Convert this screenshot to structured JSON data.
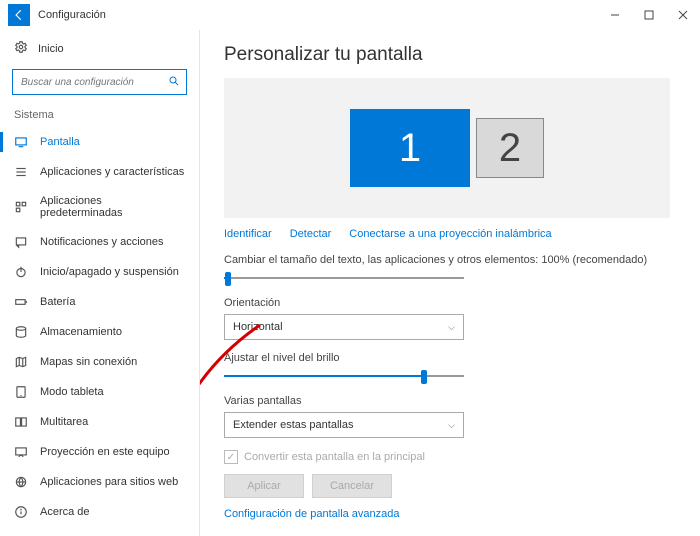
{
  "titlebar": {
    "title": "Configuración"
  },
  "sidebar": {
    "home_label": "Inicio",
    "search_placeholder": "Buscar una configuración",
    "section_label": "Sistema",
    "items": [
      {
        "label": "Pantalla"
      },
      {
        "label": "Aplicaciones y características"
      },
      {
        "label": "Aplicaciones predeterminadas"
      },
      {
        "label": "Notificaciones y acciones"
      },
      {
        "label": "Inicio/apagado y suspensión"
      },
      {
        "label": "Batería"
      },
      {
        "label": "Almacenamiento"
      },
      {
        "label": "Mapas sin conexión"
      },
      {
        "label": "Modo tableta"
      },
      {
        "label": "Multitarea"
      },
      {
        "label": "Proyección en este equipo"
      },
      {
        "label": "Aplicaciones para sitios web"
      },
      {
        "label": "Acerca de"
      }
    ]
  },
  "main": {
    "heading": "Personalizar tu pantalla",
    "monitors": {
      "primary": "1",
      "secondary": "2"
    },
    "links": {
      "identify": "Identificar",
      "detect": "Detectar",
      "wireless": "Conectarse a una proyección inalámbrica"
    },
    "scale_label": "Cambiar el tamaño del texto, las aplicaciones y otros elementos: 100% (recomendado)",
    "orientation_label": "Orientación",
    "orientation_value": "Horizontal",
    "brightness_label": "Ajustar el nivel del brillo",
    "multi_label": "Varias pantallas",
    "multi_value": "Extender estas pantallas",
    "make_primary": "Convertir esta pantalla en la principal",
    "apply": "Aplicar",
    "cancel": "Cancelar",
    "advanced": "Configuración de pantalla avanzada"
  }
}
